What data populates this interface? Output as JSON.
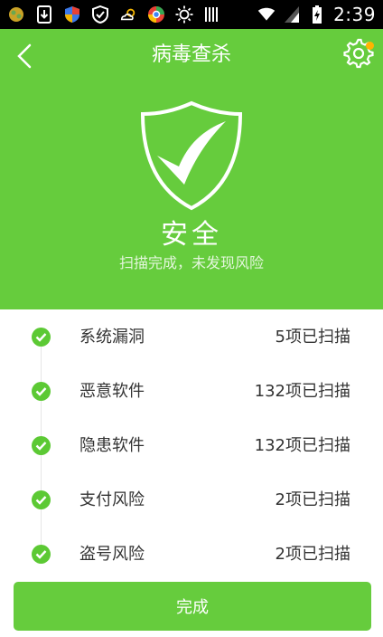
{
  "status_bar": {
    "time": "2:39",
    "icons": [
      "app-icon",
      "download-icon",
      "shield-color-icon",
      "shield-outline-icon",
      "weather-icon",
      "browser-icon",
      "sun-icon",
      "barcode-icon",
      "wifi-icon",
      "signal-icon",
      "battery-icon"
    ]
  },
  "header": {
    "title": "病毒查杀"
  },
  "result": {
    "status": "安全",
    "message": "扫描完成，未发现风险"
  },
  "scan_items": [
    {
      "label": "系统漏洞",
      "status": "5项已扫描"
    },
    {
      "label": "恶意软件",
      "status": "132项已扫描"
    },
    {
      "label": "隐患软件",
      "status": "132项已扫描"
    },
    {
      "label": "支付风险",
      "status": "2项已扫描"
    },
    {
      "label": "盗号风险",
      "status": "2项已扫描"
    }
  ],
  "footer": {
    "done_label": "完成"
  },
  "colors": {
    "primary": "#66cc3d",
    "check": "#5cc934",
    "badge": "#ffb400"
  }
}
